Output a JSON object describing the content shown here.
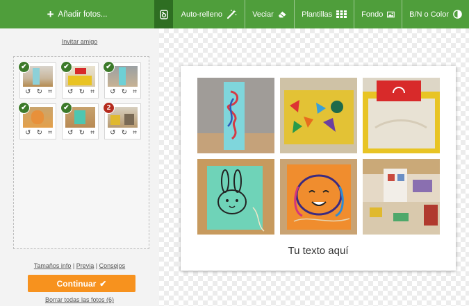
{
  "toolbar": {
    "add_photos": "Añadir fotos...",
    "auto_fill": "Auto-relleno",
    "clear": "Veciar",
    "templates": "Plantillas",
    "background": "Fondo",
    "bw_color": "B/N o Color"
  },
  "sidebar": {
    "invite": "Invitar amigo",
    "thumbs": [
      {
        "badge": "✔",
        "state": "used"
      },
      {
        "badge": "✔",
        "state": "used"
      },
      {
        "badge": "✔",
        "state": "used"
      },
      {
        "badge": "✔",
        "state": "used"
      },
      {
        "badge": "✔",
        "state": "used"
      },
      {
        "badge": "2",
        "state": "used-twice"
      }
    ],
    "links": {
      "sizes": "Tamaños info",
      "sep1": "|",
      "preview": "Previa",
      "sep2": "|",
      "tips": "Consejos"
    },
    "continue": "Continuar",
    "delete_all": "Borrar todas las fotos (6)"
  },
  "canvas": {
    "caption": "Tu texto aquí"
  },
  "colors": {
    "toolbar": "#4f9e3b",
    "accent": "#f7921e",
    "badge_ok": "#3c7a2a",
    "badge_count": "#b52b1d"
  },
  "icons": [
    "plus-icon",
    "photo-icon",
    "magic-wand-icon",
    "eraser-icon",
    "grid-icon",
    "image-icon",
    "contrast-icon",
    "rotate-left-icon",
    "rotate-right-icon",
    "crop-icon",
    "checkmark-icon"
  ]
}
